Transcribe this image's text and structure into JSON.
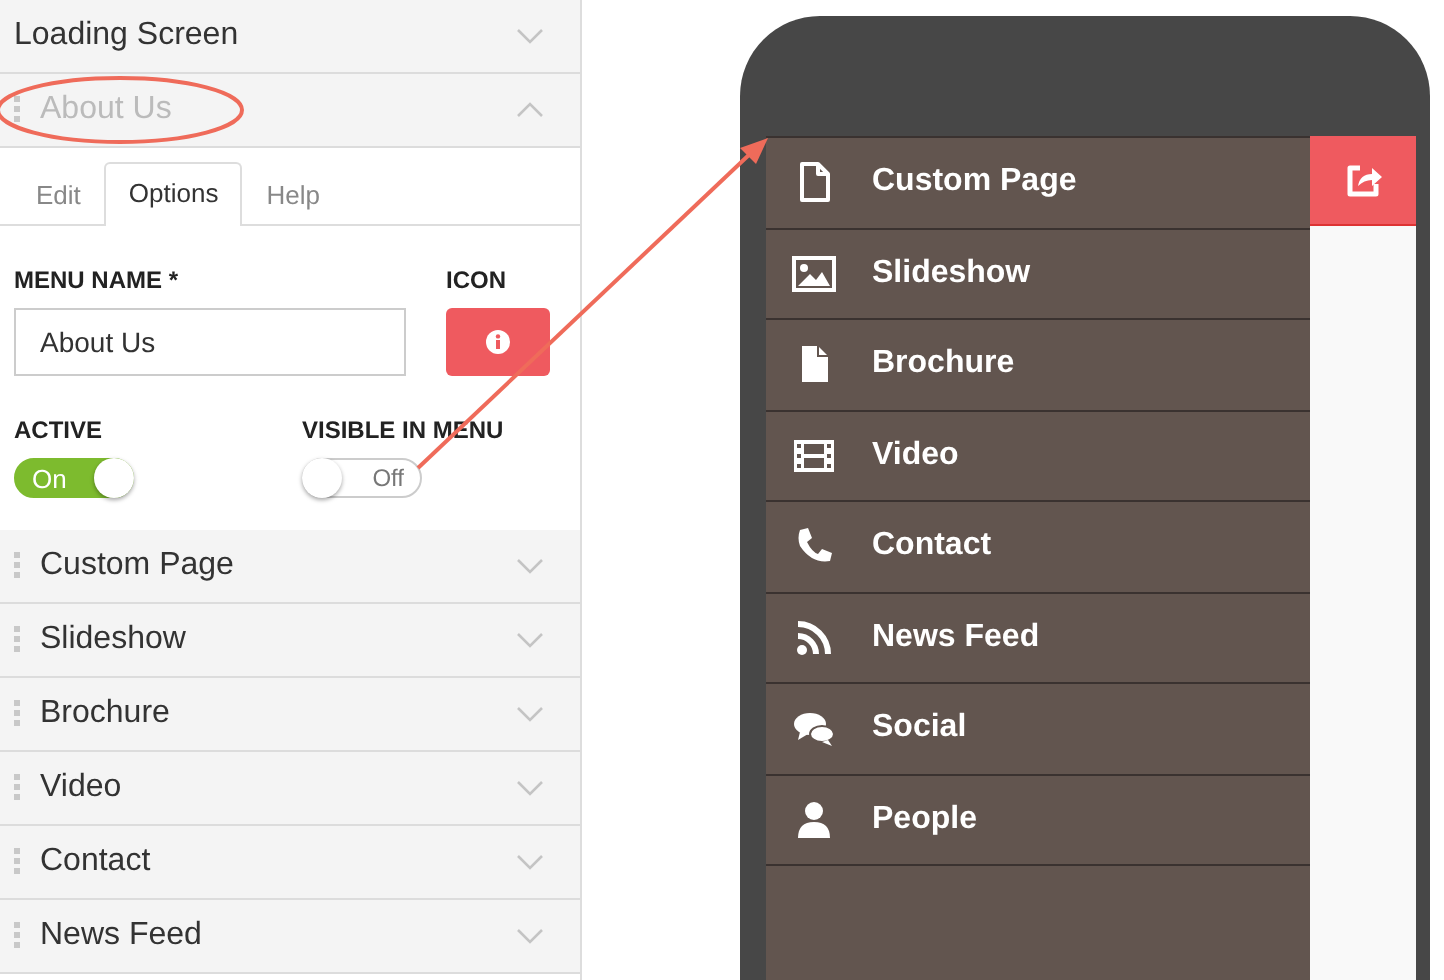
{
  "sections": [
    {
      "label": "Loading Screen",
      "expanded": false,
      "draggable": false
    },
    {
      "label": "About Us",
      "expanded": true,
      "draggable": true
    },
    {
      "label": "Custom Page",
      "expanded": false,
      "draggable": true
    },
    {
      "label": "Slideshow",
      "expanded": false,
      "draggable": true
    },
    {
      "label": "Brochure",
      "expanded": false,
      "draggable": true
    },
    {
      "label": "Video",
      "expanded": false,
      "draggable": true
    },
    {
      "label": "Contact",
      "expanded": false,
      "draggable": true
    },
    {
      "label": "News Feed",
      "expanded": false,
      "draggable": true
    }
  ],
  "editor": {
    "tabs": [
      {
        "label": "Edit",
        "selected": false
      },
      {
        "label": "Options",
        "selected": true
      },
      {
        "label": "Help",
        "selected": false
      }
    ],
    "menu_name_label": "MENU NAME *",
    "menu_name": "About Us",
    "icon_label": "ICON",
    "active": {
      "label": "ACTIVE",
      "on": true,
      "text": "On"
    },
    "visible_in_menu": {
      "label": "VISIBLE IN MENU",
      "on": false,
      "text": "Off"
    }
  },
  "phone_menu": [
    {
      "label": "Custom Page",
      "kind": "page"
    },
    {
      "label": "Slideshow",
      "kind": "image"
    },
    {
      "label": "Brochure",
      "kind": "file"
    },
    {
      "label": "Video",
      "kind": "film"
    },
    {
      "label": "Contact",
      "kind": "phone"
    },
    {
      "label": "News Feed",
      "kind": "rss"
    },
    {
      "label": "Social",
      "kind": "chat"
    },
    {
      "label": "People",
      "kind": "person"
    }
  ]
}
